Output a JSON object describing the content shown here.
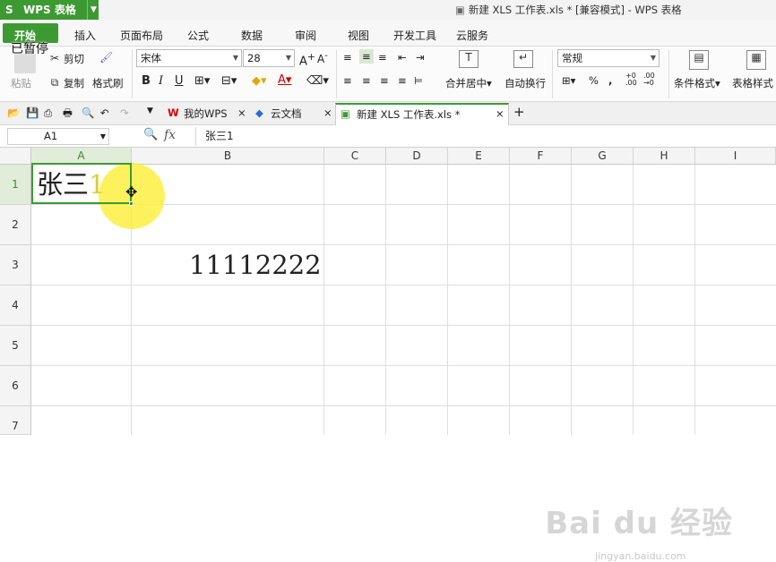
{
  "app": {
    "title": "WPS 表格",
    "window_title": "新建 XLS 工作表.xls * [兼容模式] - WPS 表格"
  },
  "ribbon_tabs": [
    "开始",
    "插入",
    "页面布局",
    "公式",
    "数据",
    "审阅",
    "视图",
    "开发工具",
    "云服务"
  ],
  "tooltip": "已暂停",
  "clipboard": {
    "paste": "粘贴",
    "cut": "剪切",
    "copy": "复制",
    "format_painter": "格式刷"
  },
  "font": {
    "name": "宋体",
    "size": "28"
  },
  "alignment": {
    "merge_center": "合并居中",
    "wrap_text": "自动换行"
  },
  "number": {
    "format": "常规",
    "percent": "%",
    "comma": ","
  },
  "styles": {
    "conditional_format": "条件格式",
    "table_style": "表格样式"
  },
  "doc_tabs": [
    {
      "label": "我的WPS"
    },
    {
      "label": "云文档"
    },
    {
      "label": "新建 XLS 工作表.xls *"
    }
  ],
  "formula_bar": {
    "name_box": "A1",
    "fx": "fx",
    "value": "张三1"
  },
  "columns": [
    "A",
    "B",
    "C",
    "D",
    "E",
    "F",
    "G",
    "H",
    "I"
  ],
  "rows": [
    "1",
    "2",
    "3",
    "4",
    "5",
    "6",
    "7"
  ],
  "cells": {
    "A1": {
      "text": "张三",
      "suffix": "1"
    },
    "B3": "11112222"
  },
  "watermark": {
    "brand": "Bai du 经验",
    "url": "jingyan.baidu.com"
  },
  "colors": {
    "accent": "#3d9a33",
    "highlight": "#fcee28"
  }
}
